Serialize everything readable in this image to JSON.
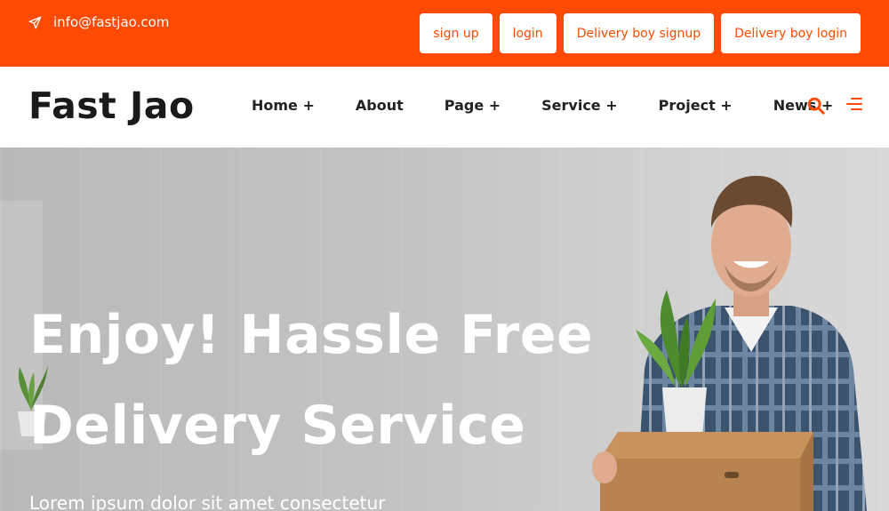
{
  "topbar": {
    "email": "info@fastjao.com",
    "buttons": [
      "sign up",
      "login",
      "Delivery boy signup",
      "Delivery boy login"
    ]
  },
  "header": {
    "logo": "Fast Jao",
    "nav": [
      "Home +",
      "About",
      "Page +",
      "Service +",
      "Project +",
      "News +"
    ]
  },
  "hero": {
    "title_line1": "Enjoy! Hassle Free",
    "title_line2": "Delivery Service",
    "subtitle": "Lorem ipsum dolor sit amet consectetur"
  },
  "colors": {
    "accent": "#ff4a03",
    "dark": "#1a1a1a"
  },
  "icons": [
    "paper-plane-icon",
    "search-icon",
    "menu-icon"
  ]
}
